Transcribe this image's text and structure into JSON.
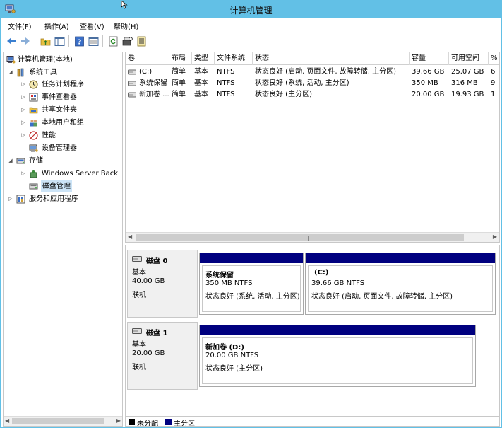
{
  "window": {
    "title": "计算机管理"
  },
  "menu": [
    {
      "label": "文件(F)"
    },
    {
      "label": "操作(A)"
    },
    {
      "label": "查看(V)"
    },
    {
      "label": "帮助(H)"
    }
  ],
  "toolbar": {
    "buttons": [
      "back-arrow-icon",
      "forward-arrow-icon",
      "up-folder-icon",
      "show-hide-tree-icon",
      "help-icon",
      "properties-icon",
      "refresh-icon",
      "rescan-icon",
      "export-list-icon"
    ]
  },
  "tree": {
    "root": "计算机管理(本地)",
    "system_tools": "系统工具",
    "task_scheduler": "任务计划程序",
    "event_viewer": "事件查看器",
    "shared_folders": "共享文件夹",
    "local_users": "本地用户和组",
    "performance": "性能",
    "device_manager": "设备管理器",
    "storage": "存储",
    "windows_backup": "Windows Server Back",
    "disk_management": "磁盘管理",
    "services_apps": "服务和应用程序"
  },
  "volume_list": {
    "headers": {
      "volume": "卷",
      "layout": "布局",
      "type": "类型",
      "fs": "文件系统",
      "status": "状态",
      "capacity": "容量",
      "free": "可用空间",
      "pct": "%"
    },
    "rows": [
      {
        "volume": "(C:)",
        "layout": "简单",
        "type": "基本",
        "fs": "NTFS",
        "status": "状态良好 (启动, 页面文件, 故障转储, 主分区)",
        "capacity": "39.66 GB",
        "free": "25.07 GB",
        "pct": "6"
      },
      {
        "volume": "系统保留",
        "layout": "简单",
        "type": "基本",
        "fs": "NTFS",
        "status": "状态良好 (系统, 活动, 主分区)",
        "capacity": "350 MB",
        "free": "316 MB",
        "pct": "9"
      },
      {
        "volume": "新加卷 ...",
        "layout": "简单",
        "type": "基本",
        "fs": "NTFS",
        "status": "状态良好 (主分区)",
        "capacity": "20.00 GB",
        "free": "19.93 GB",
        "pct": "1"
      }
    ]
  },
  "disks": [
    {
      "name": "磁盘 0",
      "kind": "基本",
      "size": "40.00 GB",
      "state": "联机",
      "partitions": [
        {
          "name": "系统保留",
          "size": "350 MB NTFS",
          "status": "状态良好 (系统, 活动, 主分区)"
        },
        {
          "name": "(C:)",
          "size": "39.66 GB NTFS",
          "status": "状态良好 (启动, 页面文件, 故障转储, 主分区)"
        }
      ]
    },
    {
      "name": "磁盘 1",
      "kind": "基本",
      "size": "20.00 GB",
      "state": "联机",
      "partitions": [
        {
          "name": "新加卷 (D:)",
          "size": "20.00 GB NTFS",
          "status": "状态良好 (主分区)"
        }
      ]
    }
  ],
  "legend": {
    "unallocated": "未分配",
    "primary": "主分区",
    "unallocated_color": "#000000",
    "primary_color": "#00007f"
  },
  "colors": {
    "title_bar": "#62c0e6",
    "partition_bar": "#00007f",
    "selection": "#cce4f7"
  }
}
